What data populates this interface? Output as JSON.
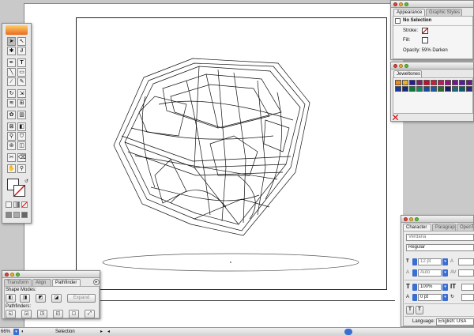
{
  "appearance": {
    "tabs": [
      "Appearance",
      "Graphic Styles"
    ],
    "no_selection": "No Selection",
    "stroke_label": "Stroke:",
    "fill_label": "Fill:",
    "opacity_text": "Opacity: 59% Darken"
  },
  "swatches": {
    "tab": "Jeweltones",
    "row1": [
      "#e88a1e",
      "#f2b020",
      "#2a1a8c",
      "#8a1a6c",
      "#c01030",
      "#d21a3a",
      "#c01a5a",
      "#a0107a",
      "#7a1290",
      "#5a1aa0",
      "#6a1a8a"
    ],
    "row2": [
      "#1a3aa0",
      "#142a80",
      "#0a7a3a",
      "#0a8a5a",
      "#1a4a9a",
      "#1a5aaa",
      "#2a6a2a",
      "#1a1a6a",
      "#1a6a7a",
      "#0a5a6a",
      "#2a2a7a"
    ]
  },
  "character": {
    "tabs": [
      "Character",
      "Paragraph",
      "OpenType"
    ],
    "font_family": "Verdana",
    "font_style": "Regular",
    "font_size": "12 pt",
    "leading": "Auto",
    "horizontal_scale": "100%",
    "baseline_shift": "0 pt",
    "language_label": "Language:",
    "language_value": "English: USA"
  },
  "pathfinder": {
    "tabs": [
      "Transform",
      "Align",
      "Pathfinder"
    ],
    "shape_modes_label": "Shape Modes:",
    "expand_label": "Expand",
    "pathfinders_label": "Pathfinders:"
  },
  "status": {
    "zoom": "66%",
    "tool": "Selection"
  }
}
